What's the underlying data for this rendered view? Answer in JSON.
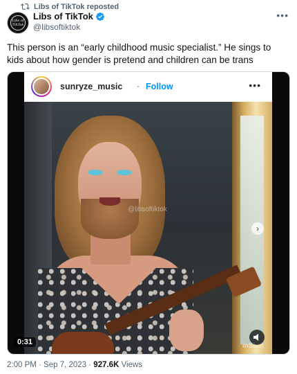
{
  "repost": {
    "label": "Libs of TikTok reposted"
  },
  "account": {
    "name": "Libs of TikTok",
    "handle": "@libsoftiktok",
    "avatar_text_1": "Libs of",
    "avatar_text_2": "TikTok"
  },
  "tweet": {
    "text": "This person is an “early childhood music specialist.” He sings to kids about how gender is pretend and children can be trans"
  },
  "media": {
    "ig_username": "sunryze_music",
    "ig_separator": "·",
    "ig_follow": "Follow",
    "watermark": "@libsoftiktok",
    "app_watermark": "InShot",
    "duration": "0:31"
  },
  "meta": {
    "time": "2:00 PM · Sep 7, 2023 · ",
    "views_count": "927.6K",
    "views_label": " Views"
  },
  "colors": {
    "verified": "#1d9bf0",
    "ig_follow": "#0095f6",
    "muted": "#536471"
  }
}
